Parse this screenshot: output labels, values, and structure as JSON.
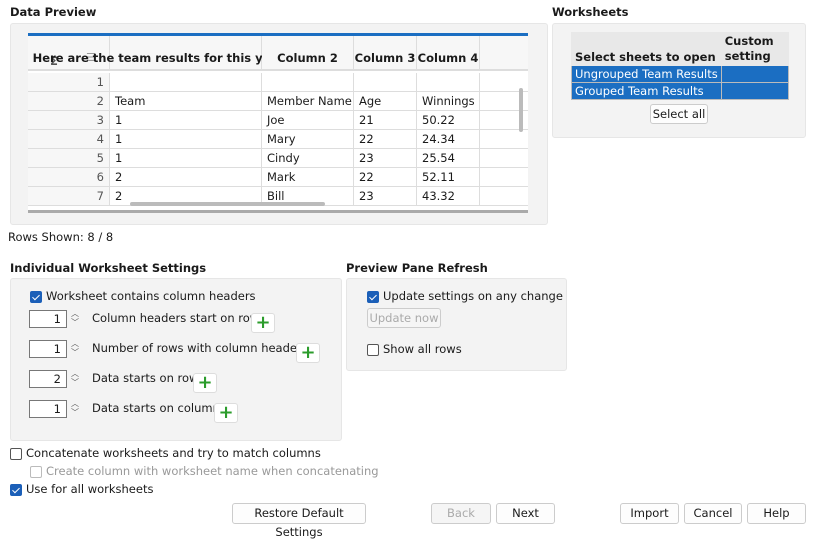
{
  "preview": {
    "title": "Data Preview",
    "sigma": "Σ",
    "headers": [
      "Here are the team results for this year's game.",
      "Column 2",
      "Column 3",
      "Column 4"
    ],
    "rows": [
      [
        "1",
        "",
        "",
        "",
        ""
      ],
      [
        "2",
        "Team",
        "Member Name",
        "Age",
        "Winnings"
      ],
      [
        "3",
        "1",
        "Joe",
        "21",
        "50.22"
      ],
      [
        "4",
        "1",
        "Mary",
        "22",
        "24.34"
      ],
      [
        "5",
        "1",
        "Cindy",
        "23",
        "25.54"
      ],
      [
        "6",
        "2",
        "Mark",
        "22",
        "52.11"
      ],
      [
        "7",
        "2",
        "Bill",
        "23",
        "43.32"
      ]
    ],
    "rows_shown": "Rows Shown: 8 / 8"
  },
  "worksheets": {
    "title": "Worksheets",
    "col1": "Select sheets to open",
    "col2": "Custom setting",
    "sheets": [
      "Ungrouped Team Results",
      "Grouped Team Results"
    ],
    "select_all": "Select all",
    "selected_color": "#1b6ec2"
  },
  "settings": {
    "title": "Individual Worksheet Settings",
    "has_headers_label": "Worksheet contains column headers",
    "has_headers": true,
    "fields": [
      {
        "label": "Column headers start on row",
        "value": "1"
      },
      {
        "label": "Number of rows with column headers",
        "value": "1"
      },
      {
        "label": "Data starts on row",
        "value": "2"
      },
      {
        "label": "Data starts on column",
        "value": "1"
      }
    ]
  },
  "refresh": {
    "title": "Preview Pane Refresh",
    "update_label": "Update settings on any change",
    "update_checked": true,
    "update_now": "Update now",
    "show_all": "Show all rows",
    "show_all_checked": false
  },
  "options": {
    "concat": "Concatenate worksheets and try to match columns",
    "create_col": "Create column with worksheet name when concatenating",
    "use_all": "Use for all worksheets"
  },
  "buttons": {
    "restore": "Restore Default Settings",
    "back": "Back",
    "next": "Next",
    "import": "Import",
    "cancel": "Cancel",
    "help": "Help"
  }
}
